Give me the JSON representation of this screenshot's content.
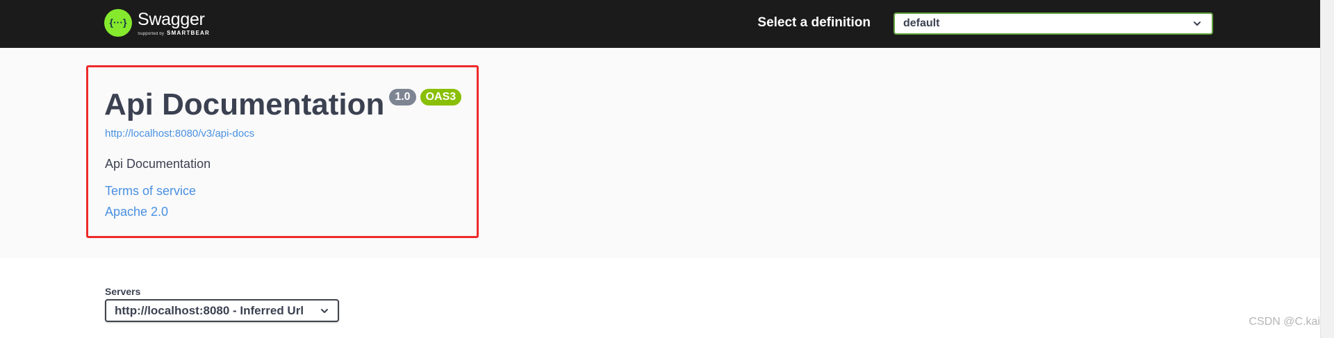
{
  "topbar": {
    "brand_name": "Swagger",
    "brand_supported_by": "Supported by",
    "brand_vendor": "SMARTBEAR",
    "logo_glyph": "{···}",
    "definition_label": "Select a definition",
    "definition_value": "default"
  },
  "info": {
    "title": "Api Documentation",
    "version_badge": "1.0",
    "oas_badge": "OAS3",
    "spec_url": "http://localhost:8080/v3/api-docs",
    "description": "Api Documentation",
    "terms_link": "Terms of service",
    "license_link": "Apache 2.0"
  },
  "servers": {
    "label": "Servers",
    "selected": "http://localhost:8080 - Inferred Url"
  },
  "watermark": "CSDN @C.kai",
  "colors": {
    "topbar_bg": "#1b1b1b",
    "brand_green": "#85ea2d",
    "select_border_green": "#62a03f",
    "link_blue": "#4990e2",
    "badge_version": "#7d8492",
    "badge_oas": "#89bf04",
    "highlight_red": "#ee2a2a"
  },
  "icons": {
    "logo": "swagger-logo-icon",
    "dropdown": "chevron-down-icon"
  }
}
